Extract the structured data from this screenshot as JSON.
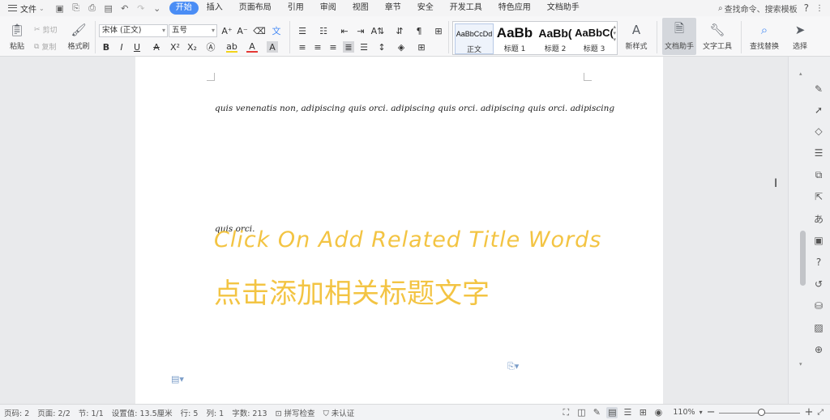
{
  "menubar": {
    "file_label": "文件",
    "tabs": [
      "开始",
      "插入",
      "页面布局",
      "引用",
      "审阅",
      "视图",
      "章节",
      "安全",
      "开发工具",
      "特色应用",
      "文档助手"
    ],
    "active_tab": "开始",
    "search_label": "查找命令、搜索模板",
    "help": "?",
    "more": "⋮"
  },
  "ribbon": {
    "paste": "粘贴",
    "cut": "剪切",
    "copy": "复制",
    "format_painter": "格式刷",
    "font_name": "宋体 (正文)",
    "font_size": "五号",
    "styles": [
      {
        "sample": "AaBbCcDd",
        "name": "正文"
      },
      {
        "sample": "AaBb",
        "name": "标题 1"
      },
      {
        "sample": "AaBb(",
        "name": "标题 2"
      },
      {
        "sample": "AaBbC(",
        "name": "标题 3"
      }
    ],
    "new_style": "新样式",
    "doc_assistant": "文档助手",
    "text_tools": "文字工具",
    "find_replace": "查找替换",
    "select": "选择"
  },
  "document": {
    "line1": "quis venenatis non, adipiscing quis orci. adipiscing quis orci. adipiscing quis orci. adipiscing",
    "line2": "quis orci.",
    "title_en": "Click On Add Related Title Words",
    "title_cn": "点击添加相关标题文字"
  },
  "statusbar": {
    "page_num": "页码: 2",
    "pages": "页面: 2/2",
    "section": "节: 1/1",
    "setting": "设置值: 13.5厘米",
    "row": "行: 5",
    "col": "列: 1",
    "word_count": "字数: 213",
    "spell_check": "拼写检查",
    "cert": "未认证",
    "zoom": "110%",
    "zoom_fraction": 0.52
  }
}
